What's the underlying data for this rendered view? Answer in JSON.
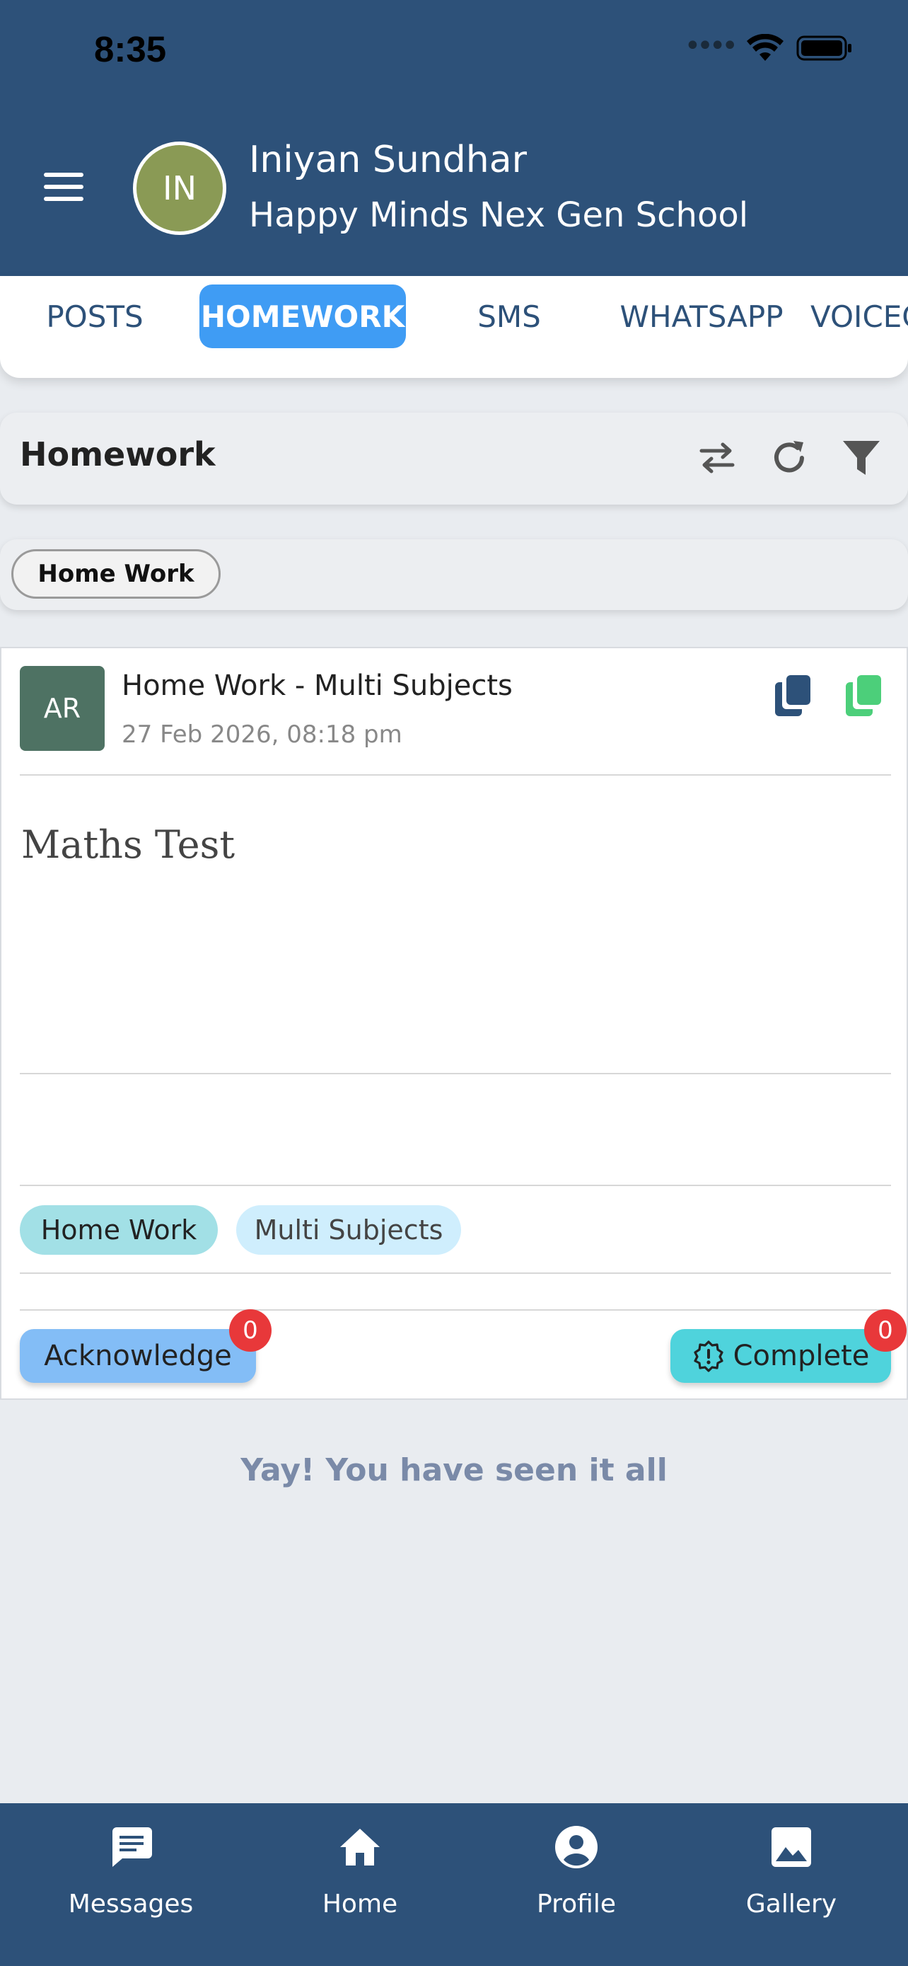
{
  "status_bar": {
    "time": "8:35"
  },
  "header": {
    "avatar_initials": "IN",
    "user_name": "Iniyan Sundhar",
    "school_name": "Happy Minds Nex Gen School"
  },
  "tabs": [
    {
      "label": "POSTS",
      "active": false
    },
    {
      "label": "HOMEWORK",
      "active": true
    },
    {
      "label": "SMS",
      "active": false
    },
    {
      "label": "WHATSAPP",
      "active": false
    },
    {
      "label": "VOICECALL",
      "active": false
    }
  ],
  "toolbar": {
    "title": "Homework",
    "icons": [
      "swap-icon",
      "refresh-icon",
      "filter-icon"
    ]
  },
  "filter_chips": [
    {
      "label": "Home Work",
      "selected": true
    }
  ],
  "post": {
    "avatar_initials": "AR",
    "title": "Home Work - Multi Subjects",
    "date": "27 Feb 2026, 08:18 pm",
    "body": "Maths Test",
    "tags": [
      "Home Work",
      "Multi Subjects"
    ],
    "acknowledge_label": "Acknowledge",
    "acknowledge_count": "0",
    "complete_label": "Complete",
    "complete_count": "0"
  },
  "end_message": "Yay! You have seen it all",
  "bottom_nav": [
    {
      "label": "Messages",
      "icon": "messages-icon"
    },
    {
      "label": "Home",
      "icon": "home-icon"
    },
    {
      "label": "Profile",
      "icon": "profile-icon"
    },
    {
      "label": "Gallery",
      "icon": "gallery-icon"
    }
  ],
  "colors": {
    "header_bg": "#2d5179",
    "active_tab": "#3f9cf4",
    "badge": "#e8383a",
    "complete_button": "#4fd3dc",
    "acknowledge_button": "#83bdf6"
  }
}
